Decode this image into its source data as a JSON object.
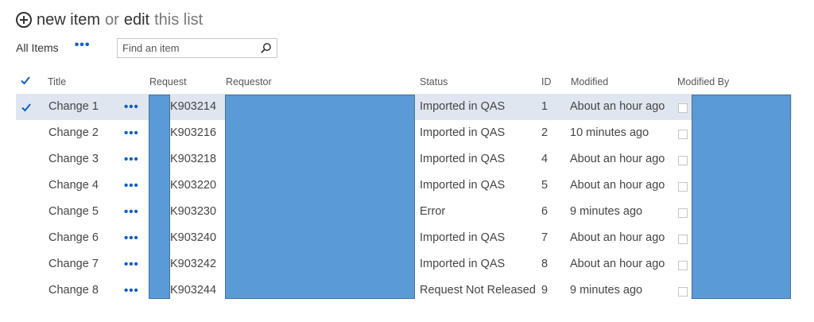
{
  "command_bar": {
    "new_item": "new item",
    "or": "or",
    "edit": "edit",
    "this_list": "this list"
  },
  "view": {
    "label": "All Items",
    "more": "•••"
  },
  "search": {
    "placeholder": "Find an item"
  },
  "columns": {
    "title": "Title",
    "request": "Request",
    "requestor": "Requestor",
    "status": "Status",
    "id": "ID",
    "modified": "Modified",
    "modified_by": "Modified By"
  },
  "colors": {
    "accent": "#0f5ec0",
    "selected_row": "#dfe6f0",
    "redaction": "#5b9bd5"
  },
  "rows": [
    {
      "title": "Change 1",
      "request": "K903214",
      "status": "Imported in QAS",
      "id": "1",
      "modified": "About an hour ago",
      "selected": true
    },
    {
      "title": "Change 2",
      "request": "K903216",
      "status": "Imported in QAS",
      "id": "2",
      "modified": "10 minutes ago",
      "selected": false
    },
    {
      "title": "Change 3",
      "request": "K903218",
      "status": "Imported in QAS",
      "id": "4",
      "modified": "About an hour ago",
      "selected": false
    },
    {
      "title": "Change 4",
      "request": "K903220",
      "status": "Imported in QAS",
      "id": "5",
      "modified": "About an hour ago",
      "selected": false
    },
    {
      "title": "Change 5",
      "request": "K903230",
      "status": "Error",
      "id": "6",
      "modified": "9 minutes ago",
      "selected": false
    },
    {
      "title": "Change 6",
      "request": "K903240",
      "status": "Imported in QAS",
      "id": "7",
      "modified": "About an hour ago",
      "selected": false
    },
    {
      "title": "Change 7",
      "request": "K903242",
      "status": "Imported in QAS",
      "id": "8",
      "modified": "About an hour ago",
      "selected": false
    },
    {
      "title": "Change 8",
      "request": "K903244",
      "status": "Request Not Released",
      "id": "9",
      "modified": "9 minutes ago",
      "selected": false
    }
  ],
  "row_ellipsis": "•••"
}
